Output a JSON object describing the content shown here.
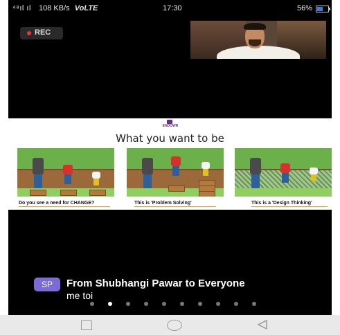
{
  "status_bar": {
    "signal": "⁴⁸ıl ıl",
    "speed": "108 KB/s",
    "network": "VoLTE",
    "time": "17:30",
    "battery": "56%",
    "battery_level": 0.56
  },
  "recording": {
    "label": "REC",
    "dot_color": "#e53935"
  },
  "slide": {
    "logo_text": "ENDOWR",
    "title": "What you want to be",
    "panels": [
      {
        "caption": "Do you see a need for CHANGE?"
      },
      {
        "caption": "This is 'Problem Solving'"
      },
      {
        "caption": "This is a 'Design Thinking'"
      }
    ]
  },
  "chat": {
    "avatar_initials": "SP",
    "avatar_color": "#7c6bd6",
    "sender_line": "From Shubhangi Pawar to Everyone",
    "message": "me toi"
  },
  "pager": {
    "total": 10,
    "active_index": 1
  },
  "nav_bar": {
    "icons": [
      "recent-apps-icon",
      "home-icon",
      "back-icon"
    ]
  }
}
